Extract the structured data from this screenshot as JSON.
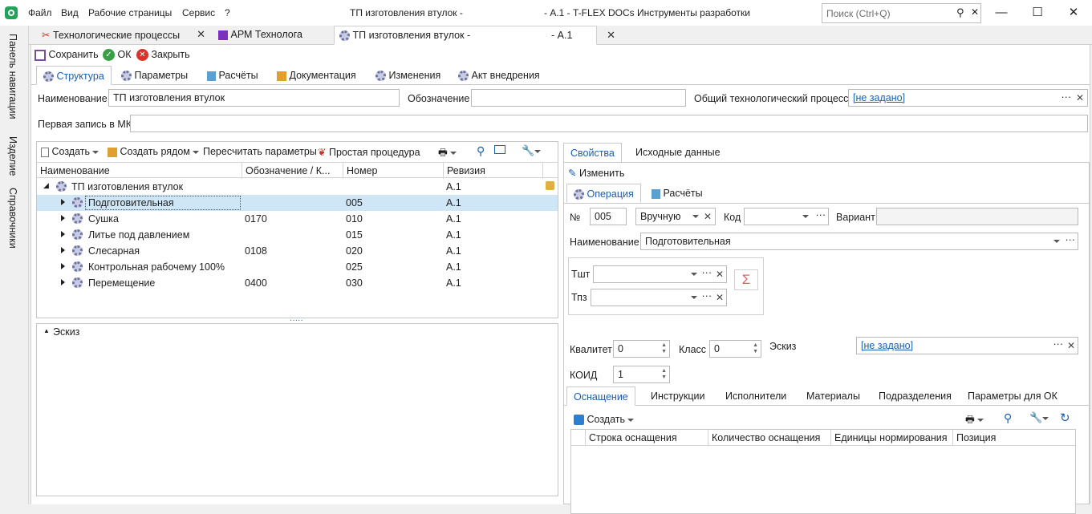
{
  "menu": {
    "file": "Файл",
    "view": "Вид",
    "workpages": "Рабочие страницы",
    "service": "Сервис",
    "help": "?"
  },
  "window": {
    "title_left": "ТП изготовления втулок -",
    "title_right": "- А.1 - T-FLEX DOCs Инструменты разработки"
  },
  "search": {
    "placeholder": "Поиск (Ctrl+Q)"
  },
  "sidebar": {
    "items": [
      "Панель навигации",
      "Изделие",
      "Справочники"
    ]
  },
  "doc_tabs": [
    {
      "label": "Технологические процессы"
    },
    {
      "label": "АРМ Технолога"
    },
    {
      "label": "ТП изготовления втулок -",
      "suffix": "- А.1"
    }
  ],
  "toolbar": {
    "save": "Сохранить",
    "ok": "ОК",
    "close": "Закрыть"
  },
  "page_tabs": [
    "Структура",
    "Параметры",
    "Расчёты",
    "Документация",
    "Изменения",
    "Акт внедрения"
  ],
  "header_fields": {
    "name_label": "Наименование",
    "name_value": "ТП изготовления втулок",
    "designation_label": "Обозначение",
    "designation_value": "",
    "common_process_label": "Общий технологический процесс",
    "common_process_value": "[не задано]",
    "first_record_label": "Первая запись в МК",
    "first_record_value": ""
  },
  "left_toolbar": {
    "create": "Создать",
    "create_near": "Создать рядом",
    "recalc": "Пересчитать параметры",
    "simple_proc": "Простая процедура"
  },
  "tree": {
    "columns": [
      "Наименование",
      "Обозначение / К...",
      "Номер",
      "Ревизия"
    ],
    "root": {
      "name": "ТП изготовления втулок",
      "revision": "А.1"
    },
    "rows": [
      {
        "name": "Подготовительная",
        "designation": "",
        "number": "005",
        "revision": "А.1"
      },
      {
        "name": "Сушка",
        "designation": "0170",
        "number": "010",
        "revision": "А.1"
      },
      {
        "name": "Литье под давлением",
        "designation": "",
        "number": "015",
        "revision": "А.1"
      },
      {
        "name": "Слесарная",
        "designation": "0108",
        "number": "020",
        "revision": "А.1"
      },
      {
        "name": "Контрольная рабочему 100%",
        "designation": "",
        "number": "025",
        "revision": "А.1"
      },
      {
        "name": "Перемещение",
        "designation": "0400",
        "number": "030",
        "revision": "А.1"
      }
    ]
  },
  "sketch_panel": {
    "label": "Эскиз"
  },
  "right": {
    "tabs": [
      "Свойства",
      "Исходные данные"
    ],
    "edit": "Изменить",
    "op_tabs": [
      "Операция",
      "Расчёты"
    ],
    "no_label": "№",
    "no_value": "005",
    "mode_value": "Вручную",
    "code_label": "Код",
    "code_value": "",
    "variant_label": "Вариант",
    "variant_value": "",
    "name_label": "Наименование",
    "name_value": "Подготовительная",
    "tsht_label": "Тшт",
    "tpz_label": "Тпз",
    "kvalitet_label": "Квалитет",
    "kvalitet_value": "0",
    "class_label": "Класс",
    "class_value": "0",
    "sketch_label": "Эскиз",
    "sketch_value": "[не задано]",
    "koid_label": "КОИД",
    "koid_value": "1",
    "sub_tabs": [
      "Оснащение",
      "Инструкции",
      "Исполнители",
      "Материалы",
      "Подразделения",
      "Параметры для ОК"
    ],
    "create": "Создать",
    "equip_columns": [
      "Строка оснащения",
      "Количество оснащения",
      "Единицы нормирования",
      "Позиция"
    ]
  }
}
